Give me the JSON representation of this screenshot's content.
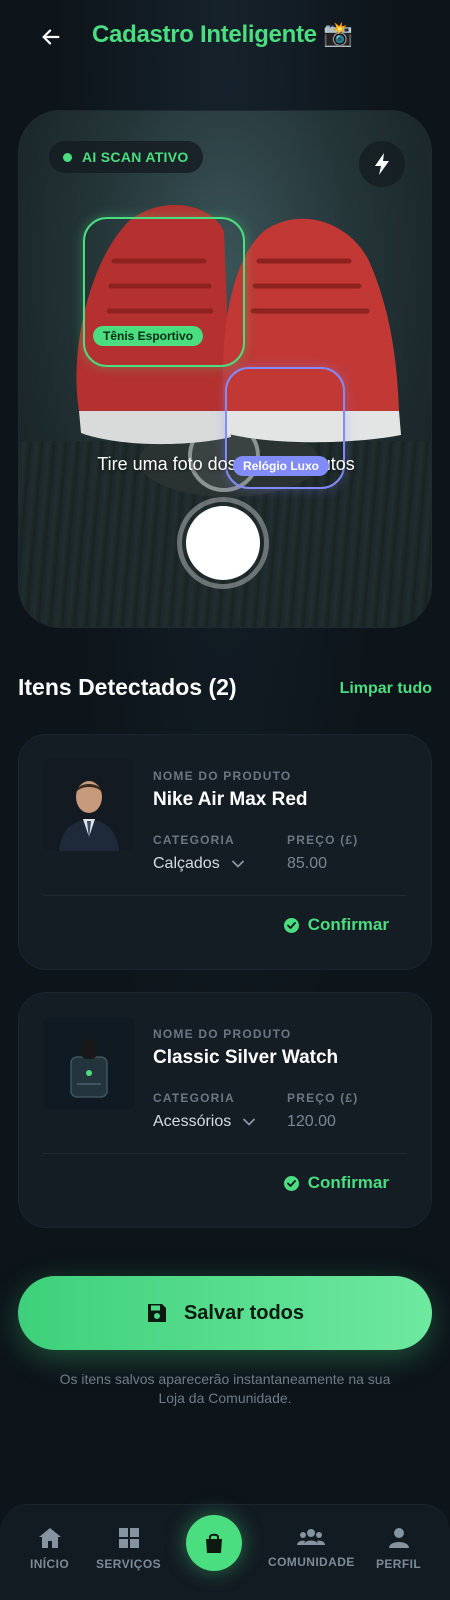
{
  "header": {
    "title": "Cadastro Inteligente 📸"
  },
  "camera": {
    "scan_status": "AI SCAN ATIVO",
    "hint": "Tire uma foto dos seus produtos",
    "detections": [
      {
        "label": "Tênis Esportivo",
        "color": "#4ade80"
      },
      {
        "label": "Relógio Luxo",
        "color": "#818cf8"
      }
    ]
  },
  "detected": {
    "title": "Itens Detectados (2)",
    "clear_label": "Limpar tudo",
    "field_labels": {
      "name": "NOME DO PRODUTO",
      "category": "CATEGORIA",
      "price": "PREÇO (£)"
    },
    "items": [
      {
        "name": "Nike Air Max Red",
        "category": "Calçados",
        "price": "85.00",
        "confirm": "Confirmar"
      },
      {
        "name": "Classic Silver Watch",
        "category": "Acessórios",
        "price": "120.00",
        "confirm": "Confirmar"
      }
    ]
  },
  "save": {
    "label": "Salvar todos",
    "note": "Os itens salvos aparecerão instantaneamente na sua Loja da Comunidade."
  },
  "nav": {
    "items": [
      {
        "label": "INÍCIO",
        "icon": "home-icon"
      },
      {
        "label": "SERVIÇOS",
        "icon": "grid-icon"
      },
      {
        "label": "",
        "icon": "shopping-bag-icon"
      },
      {
        "label": "COMUNIDADE",
        "icon": "people-icon"
      },
      {
        "label": "PERFIL",
        "icon": "user-icon"
      }
    ]
  },
  "colors": {
    "accent": "#4ade80",
    "secondary": "#818cf8",
    "background": "#0d141a",
    "card": "#141c24"
  }
}
